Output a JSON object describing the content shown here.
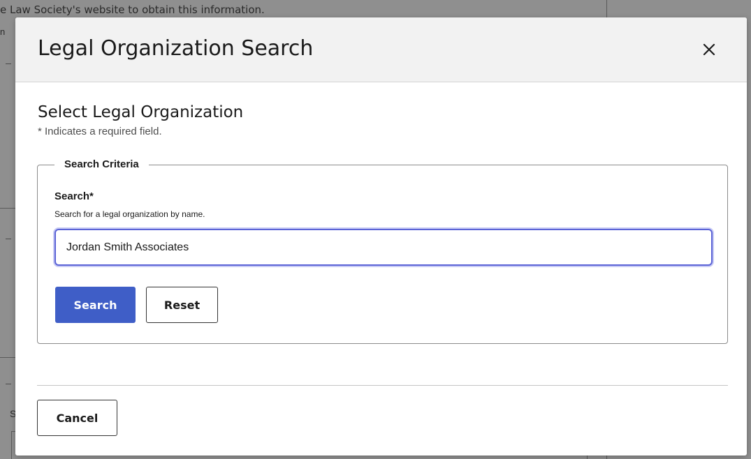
{
  "background": {
    "text_top": "e Law Society's website to obtain this information.",
    "frag_left": "n",
    "frag_bottom": "S"
  },
  "modal": {
    "title": "Legal Organization Search",
    "close_icon": "close-icon",
    "section_title": "Select Legal Organization",
    "required_note": "* Indicates a required field.",
    "fieldset": {
      "legend": "Search Criteria",
      "search_label": "Search*",
      "search_hint": "Search for a legal organization by name.",
      "search_value": "Jordan Smith Associates",
      "search_button": "Search",
      "reset_button": "Reset"
    },
    "cancel_button": "Cancel"
  },
  "colors": {
    "primary": "#3f5ec7",
    "focus_ring": "#5b63d6",
    "overlay": "#8f8f8f"
  }
}
